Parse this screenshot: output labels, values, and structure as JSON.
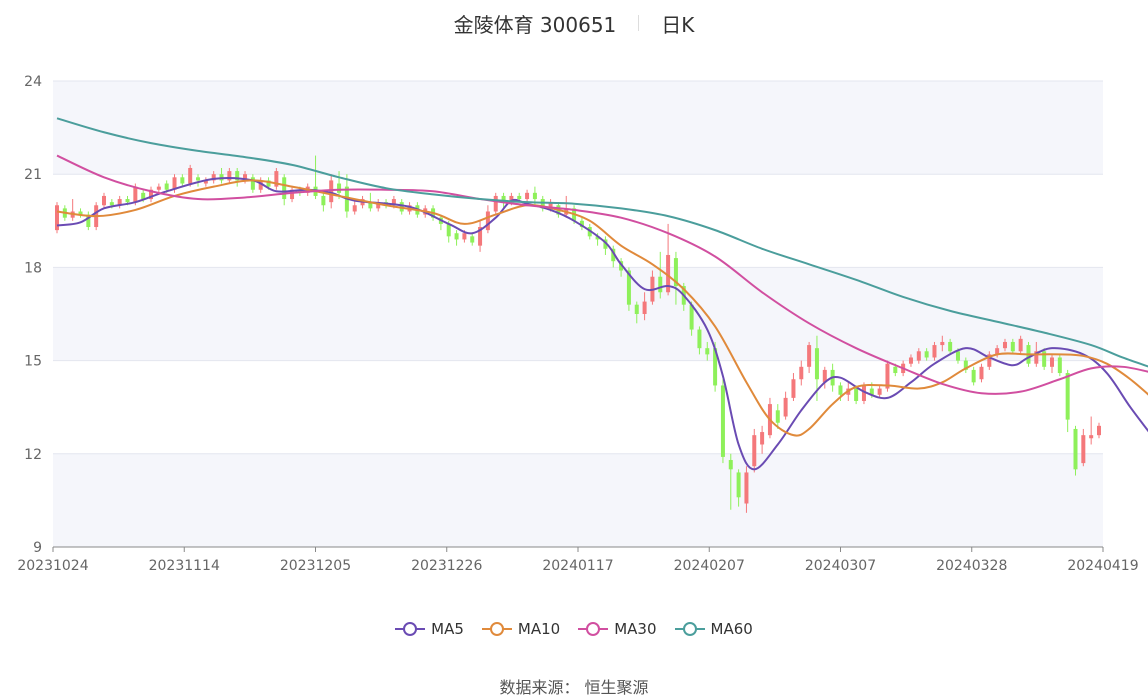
{
  "title": {
    "name": "金陵体育 300651",
    "period": "日K"
  },
  "source": "数据来源： 恒生聚源",
  "chart_data": {
    "type": "candlestick",
    "y_ticks": [
      "24",
      "21",
      "18",
      "15",
      "12",
      "9"
    ],
    "ylim": [
      9,
      24
    ],
    "x_tick_labels": [
      "20231024",
      "20231114",
      "20231205",
      "20231226",
      "20240117",
      "20240207",
      "20240307",
      "20240328",
      "20240419"
    ],
    "colors": {
      "up": "#f4787b",
      "down": "#8ef05a",
      "band": "#f5f6fb",
      "grid": "#e3e6ef"
    },
    "candles": [
      [
        19.2,
        20.0,
        19.1,
        20.1
      ],
      [
        19.9,
        19.6,
        19.5,
        20.0
      ],
      [
        19.6,
        19.8,
        19.5,
        20.2
      ],
      [
        19.8,
        19.7,
        19.6,
        19.9
      ],
      [
        19.7,
        19.3,
        19.2,
        19.8
      ],
      [
        19.3,
        20.0,
        19.2,
        20.1
      ],
      [
        20.0,
        20.3,
        19.9,
        20.4
      ],
      [
        20.1,
        20.0,
        19.9,
        20.2
      ],
      [
        20.0,
        20.2,
        19.9,
        20.3
      ],
      [
        20.2,
        20.1,
        20.0,
        20.3
      ],
      [
        20.1,
        20.6,
        20.0,
        20.7
      ],
      [
        20.4,
        20.2,
        20.1,
        20.5
      ],
      [
        20.2,
        20.5,
        20.1,
        20.6
      ],
      [
        20.5,
        20.6,
        20.4,
        20.7
      ],
      [
        20.7,
        20.5,
        20.4,
        20.8
      ],
      [
        20.5,
        20.9,
        20.4,
        21.0
      ],
      [
        20.9,
        20.7,
        20.6,
        21.0
      ],
      [
        20.7,
        21.2,
        20.6,
        21.3
      ],
      [
        20.9,
        20.8,
        20.6,
        21.0
      ],
      [
        20.7,
        20.8,
        20.6,
        20.9
      ],
      [
        20.8,
        21.0,
        20.7,
        21.1
      ],
      [
        21.0,
        20.8,
        20.7,
        21.2
      ],
      [
        20.8,
        21.1,
        20.7,
        21.2
      ],
      [
        21.1,
        20.8,
        20.6,
        21.2
      ],
      [
        20.8,
        21.0,
        20.7,
        21.1
      ],
      [
        20.9,
        20.5,
        20.4,
        21.0
      ],
      [
        20.5,
        20.8,
        20.4,
        20.9
      ],
      [
        20.8,
        20.6,
        20.5,
        20.9
      ],
      [
        20.6,
        21.1,
        20.5,
        21.2
      ],
      [
        20.9,
        20.2,
        20.0,
        21.0
      ],
      [
        20.2,
        20.5,
        20.1,
        20.6
      ],
      [
        20.5,
        20.4,
        20.3,
        20.6
      ],
      [
        20.4,
        20.6,
        20.3,
        20.7
      ],
      [
        20.6,
        20.3,
        20.2,
        21.6
      ],
      [
        20.3,
        20.0,
        19.8,
        20.4
      ],
      [
        20.1,
        20.8,
        19.9,
        21.0
      ],
      [
        20.7,
        20.4,
        20.2,
        21.1
      ],
      [
        20.6,
        19.8,
        19.6,
        21.0
      ],
      [
        19.8,
        20.0,
        19.7,
        20.2
      ],
      [
        20.0,
        20.2,
        19.9,
        20.3
      ],
      [
        20.1,
        19.9,
        19.8,
        20.4
      ],
      [
        19.9,
        20.1,
        19.8,
        20.2
      ],
      [
        20.1,
        20.0,
        19.9,
        20.2
      ],
      [
        20.0,
        20.2,
        19.9,
        20.3
      ],
      [
        20.1,
        19.8,
        19.7,
        20.2
      ],
      [
        19.8,
        20.0,
        19.7,
        20.1
      ],
      [
        20.0,
        19.7,
        19.6,
        20.1
      ],
      [
        19.7,
        19.9,
        19.6,
        20.0
      ],
      [
        19.9,
        19.6,
        19.5,
        20.0
      ],
      [
        19.6,
        19.4,
        19.2,
        19.7
      ],
      [
        19.4,
        19.0,
        18.8,
        19.5
      ],
      [
        19.1,
        18.9,
        18.7,
        19.2
      ],
      [
        18.9,
        19.1,
        18.8,
        19.2
      ],
      [
        19.0,
        18.8,
        18.7,
        19.1
      ],
      [
        18.7,
        19.3,
        18.5,
        19.5
      ],
      [
        19.2,
        19.8,
        19.1,
        20.0
      ],
      [
        19.8,
        20.3,
        19.7,
        20.4
      ],
      [
        20.3,
        20.1,
        19.9,
        20.4
      ],
      [
        20.1,
        20.3,
        20.0,
        20.4
      ],
      [
        20.3,
        20.2,
        20.1,
        20.4
      ],
      [
        20.2,
        20.4,
        20.1,
        20.5
      ],
      [
        20.4,
        20.2,
        20.0,
        20.6
      ],
      [
        20.2,
        19.9,
        19.8,
        20.3
      ],
      [
        19.9,
        20.1,
        19.8,
        20.2
      ],
      [
        20.0,
        19.7,
        19.6,
        20.1
      ],
      [
        19.7,
        19.9,
        19.6,
        20.3
      ],
      [
        19.9,
        19.5,
        19.4,
        20.0
      ],
      [
        19.5,
        19.3,
        19.2,
        19.6
      ],
      [
        19.3,
        19.0,
        18.9,
        19.4
      ],
      [
        19.0,
        18.9,
        18.7,
        19.1
      ],
      [
        18.9,
        18.6,
        18.4,
        19.0
      ],
      [
        18.6,
        18.2,
        18.0,
        18.7
      ],
      [
        18.2,
        17.9,
        17.7,
        18.3
      ],
      [
        17.9,
        16.8,
        16.6,
        18.0
      ],
      [
        16.8,
        16.5,
        16.2,
        16.9
      ],
      [
        16.5,
        16.9,
        16.3,
        17.2
      ],
      [
        16.9,
        17.7,
        16.8,
        17.9
      ],
      [
        17.7,
        17.2,
        17.0,
        18.5
      ],
      [
        17.2,
        18.4,
        17.1,
        19.4
      ],
      [
        18.3,
        17.4,
        16.8,
        18.5
      ],
      [
        17.4,
        16.8,
        16.6,
        17.5
      ],
      [
        16.8,
        16.0,
        15.8,
        16.9
      ],
      [
        16.0,
        15.4,
        15.2,
        16.1
      ],
      [
        15.4,
        15.2,
        15.0,
        15.6
      ],
      [
        15.4,
        14.2,
        14.0,
        15.6
      ],
      [
        14.2,
        11.9,
        11.7,
        14.4
      ],
      [
        11.8,
        11.5,
        10.2,
        12.0
      ],
      [
        11.4,
        10.6,
        10.3,
        11.5
      ],
      [
        10.4,
        11.4,
        10.1,
        11.6
      ],
      [
        11.6,
        12.6,
        11.4,
        12.8
      ],
      [
        12.3,
        12.7,
        12.0,
        12.9
      ],
      [
        12.6,
        13.6,
        12.5,
        13.8
      ],
      [
        13.4,
        13.0,
        12.8,
        13.6
      ],
      [
        13.2,
        13.8,
        13.1,
        14.0
      ],
      [
        13.8,
        14.4,
        13.7,
        14.6
      ],
      [
        14.4,
        14.8,
        14.2,
        15.0
      ],
      [
        14.8,
        15.5,
        14.6,
        15.6
      ],
      [
        15.4,
        14.4,
        13.7,
        15.8
      ],
      [
        14.3,
        14.7,
        14.1,
        14.8
      ],
      [
        14.7,
        14.2,
        14.0,
        14.9
      ],
      [
        14.2,
        13.9,
        13.7,
        14.3
      ],
      [
        13.9,
        14.1,
        13.7,
        14.3
      ],
      [
        14.1,
        13.7,
        13.6,
        14.2
      ],
      [
        13.7,
        14.2,
        13.6,
        14.3
      ],
      [
        14.1,
        13.9,
        13.8,
        14.3
      ],
      [
        13.9,
        14.1,
        13.8,
        14.2
      ],
      [
        14.1,
        14.9,
        14.0,
        15.0
      ],
      [
        14.8,
        14.6,
        14.5,
        14.9
      ],
      [
        14.6,
        14.9,
        14.5,
        15.0
      ],
      [
        14.9,
        15.1,
        14.8,
        15.2
      ],
      [
        15.0,
        15.3,
        14.9,
        15.4
      ],
      [
        15.3,
        15.1,
        15.0,
        15.4
      ],
      [
        15.1,
        15.5,
        15.0,
        15.6
      ],
      [
        15.5,
        15.6,
        15.3,
        15.8
      ],
      [
        15.6,
        15.3,
        15.2,
        15.7
      ],
      [
        15.3,
        15.0,
        14.9,
        15.4
      ],
      [
        15.0,
        14.7,
        14.6,
        15.1
      ],
      [
        14.7,
        14.3,
        14.2,
        14.8
      ],
      [
        14.4,
        14.8,
        14.3,
        14.9
      ],
      [
        14.8,
        15.2,
        14.7,
        15.3
      ],
      [
        15.2,
        15.4,
        15.1,
        15.5
      ],
      [
        15.4,
        15.6,
        15.3,
        15.7
      ],
      [
        15.6,
        15.3,
        15.2,
        15.7
      ],
      [
        15.3,
        15.7,
        15.2,
        15.8
      ],
      [
        15.5,
        14.9,
        14.8,
        15.6
      ],
      [
        14.9,
        15.3,
        14.8,
        15.6
      ],
      [
        15.3,
        14.8,
        14.7,
        15.4
      ],
      [
        14.8,
        15.1,
        14.6,
        15.2
      ],
      [
        15.1,
        14.6,
        14.5,
        15.2
      ],
      [
        14.6,
        13.1,
        12.7,
        14.7
      ],
      [
        12.8,
        11.5,
        11.3,
        12.9
      ],
      [
        11.7,
        12.6,
        11.6,
        12.8
      ],
      [
        12.5,
        12.6,
        12.3,
        13.2
      ],
      [
        12.6,
        12.9,
        12.5,
        13.0
      ]
    ],
    "series": [
      {
        "name": "MA5",
        "color": "#6a4bb3",
        "values": [
          [
            0,
            19.35
          ],
          [
            3,
            19.45
          ],
          [
            6,
            19.9
          ],
          [
            10,
            20.1
          ],
          [
            14,
            20.45
          ],
          [
            20,
            20.85
          ],
          [
            25,
            20.8
          ],
          [
            28,
            20.45
          ],
          [
            32,
            20.5
          ],
          [
            35,
            20.4
          ],
          [
            38,
            20.15
          ],
          [
            45,
            19.95
          ],
          [
            50,
            19.4
          ],
          [
            53,
            19.1
          ],
          [
            56,
            19.6
          ],
          [
            58,
            20.15
          ],
          [
            60,
            20.05
          ],
          [
            63,
            19.85
          ],
          [
            66,
            19.5
          ],
          [
            70,
            18.8
          ],
          [
            72,
            18.1
          ],
          [
            75,
            17.3
          ],
          [
            78,
            17.4
          ],
          [
            80,
            17.1
          ],
          [
            83,
            16.0
          ],
          [
            85,
            14.5
          ],
          [
            87,
            12.3
          ],
          [
            89,
            11.5
          ],
          [
            92,
            12.3
          ],
          [
            95,
            13.4
          ],
          [
            98,
            14.3
          ],
          [
            100,
            14.45
          ],
          [
            103,
            14.0
          ],
          [
            106,
            13.8
          ],
          [
            109,
            14.3
          ],
          [
            112,
            14.9
          ],
          [
            116,
            15.4
          ],
          [
            119,
            15.1
          ],
          [
            122,
            14.85
          ],
          [
            124,
            15.1
          ],
          [
            127,
            15.4
          ],
          [
            131,
            15.2
          ],
          [
            134,
            14.6
          ],
          [
            137,
            13.5
          ],
          [
            140,
            12.5
          ]
        ]
      },
      {
        "name": "MA10",
        "color": "#e08a3b",
        "values": [
          [
            0,
            19.8
          ],
          [
            5,
            19.65
          ],
          [
            10,
            19.85
          ],
          [
            15,
            20.3
          ],
          [
            20,
            20.6
          ],
          [
            25,
            20.8
          ],
          [
            30,
            20.6
          ],
          [
            36,
            20.3
          ],
          [
            42,
            20.0
          ],
          [
            48,
            19.75
          ],
          [
            52,
            19.4
          ],
          [
            56,
            19.7
          ],
          [
            60,
            20.0
          ],
          [
            64,
            19.85
          ],
          [
            68,
            19.5
          ],
          [
            72,
            18.7
          ],
          [
            76,
            18.1
          ],
          [
            80,
            17.3
          ],
          [
            84,
            16.1
          ],
          [
            88,
            14.3
          ],
          [
            91,
            13.1
          ],
          [
            94,
            12.6
          ],
          [
            96,
            12.8
          ],
          [
            99,
            13.6
          ],
          [
            102,
            14.15
          ],
          [
            106,
            14.2
          ],
          [
            110,
            14.1
          ],
          [
            113,
            14.3
          ],
          [
            116,
            14.75
          ],
          [
            120,
            15.2
          ],
          [
            124,
            15.2
          ],
          [
            128,
            15.2
          ],
          [
            131,
            15.15
          ],
          [
            134,
            14.9
          ],
          [
            137,
            14.4
          ],
          [
            140,
            13.75
          ]
        ]
      },
      {
        "name": "MA30",
        "color": "#d14fa0",
        "values": [
          [
            0,
            21.6
          ],
          [
            6,
            20.9
          ],
          [
            12,
            20.45
          ],
          [
            18,
            20.2
          ],
          [
            24,
            20.25
          ],
          [
            30,
            20.4
          ],
          [
            36,
            20.5
          ],
          [
            42,
            20.5
          ],
          [
            48,
            20.45
          ],
          [
            54,
            20.2
          ],
          [
            60,
            20.0
          ],
          [
            66,
            19.85
          ],
          [
            72,
            19.6
          ],
          [
            78,
            19.1
          ],
          [
            84,
            18.35
          ],
          [
            90,
            17.2
          ],
          [
            96,
            16.2
          ],
          [
            102,
            15.4
          ],
          [
            108,
            14.75
          ],
          [
            113,
            14.25
          ],
          [
            118,
            13.95
          ],
          [
            123,
            14.0
          ],
          [
            128,
            14.4
          ],
          [
            132,
            14.75
          ],
          [
            136,
            14.8
          ],
          [
            140,
            14.6
          ]
        ]
      },
      {
        "name": "MA60",
        "color": "#4b9e9c",
        "values": [
          [
            0,
            22.8
          ],
          [
            6,
            22.35
          ],
          [
            12,
            22.0
          ],
          [
            18,
            21.75
          ],
          [
            24,
            21.55
          ],
          [
            30,
            21.3
          ],
          [
            36,
            20.9
          ],
          [
            42,
            20.55
          ],
          [
            48,
            20.35
          ],
          [
            54,
            20.2
          ],
          [
            60,
            20.1
          ],
          [
            66,
            20.05
          ],
          [
            72,
            19.9
          ],
          [
            78,
            19.65
          ],
          [
            84,
            19.2
          ],
          [
            90,
            18.6
          ],
          [
            96,
            18.1
          ],
          [
            102,
            17.6
          ],
          [
            108,
            17.05
          ],
          [
            114,
            16.6
          ],
          [
            120,
            16.25
          ],
          [
            126,
            15.9
          ],
          [
            132,
            15.5
          ],
          [
            136,
            15.1
          ],
          [
            140,
            14.75
          ]
        ]
      }
    ]
  }
}
